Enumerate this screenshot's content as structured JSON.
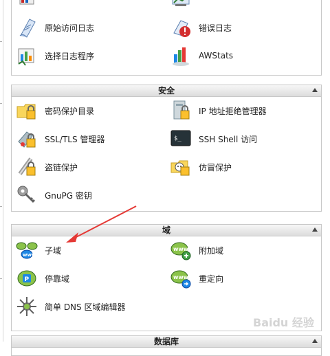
{
  "stats_section": {
    "items": [
      {
        "label": "原始访问日志",
        "icon": "raw-log-icon"
      },
      {
        "label": "错误日志",
        "icon": "error-log-icon"
      },
      {
        "label": "选择日志程序",
        "icon": "log-program-icon"
      },
      {
        "label": "AWStats",
        "icon": "awstats-icon"
      }
    ]
  },
  "security_section": {
    "title": "安全",
    "items": [
      {
        "label": "密码保护目录",
        "icon": "password-folder-icon"
      },
      {
        "label": "IP 地址拒绝管理器",
        "icon": "ip-deny-icon"
      },
      {
        "label": "SSL/TLS 管理器",
        "icon": "ssl-icon"
      },
      {
        "label": "SSH Shell 访问",
        "icon": "ssh-terminal-icon"
      },
      {
        "label": "盗链保护",
        "icon": "hotlink-icon"
      },
      {
        "label": "仿冒保护",
        "icon": "leech-protect-icon"
      },
      {
        "label": "GnuPG 密钥",
        "icon": "gnupg-key-icon"
      }
    ]
  },
  "domains_section": {
    "title": "域",
    "items": [
      {
        "label": "子域",
        "icon": "subdomain-icon"
      },
      {
        "label": "附加域",
        "icon": "addon-domain-icon"
      },
      {
        "label": "停靠域",
        "icon": "parked-domain-icon"
      },
      {
        "label": "重定向",
        "icon": "redirect-icon"
      },
      {
        "label": "简单 DNS 区域编辑器",
        "icon": "dns-editor-icon"
      }
    ]
  },
  "database_section": {
    "title": "数据库"
  },
  "watermark": "Baidu 经验",
  "colors": {
    "annotation_arrow": "#e53935",
    "panel_border": "#c8c8c8",
    "header_gradient": "#dcdcdc"
  }
}
